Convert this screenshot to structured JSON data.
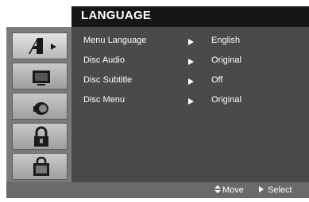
{
  "menu": {
    "title": "LANGUAGE"
  },
  "tabs": [
    {
      "icon": "language-icon",
      "active": true
    },
    {
      "icon": "display-icon",
      "active": false
    },
    {
      "icon": "audio-icon",
      "active": false
    },
    {
      "icon": "lock-icon",
      "active": false
    },
    {
      "icon": "others-icon",
      "active": false
    }
  ],
  "settings": [
    {
      "label": "Menu Language",
      "value": "English"
    },
    {
      "label": "Disc Audio",
      "value": "Original"
    },
    {
      "label": "Disc Subtitle",
      "value": "Off"
    },
    {
      "label": "Disc Menu",
      "value": "Original"
    }
  ],
  "footer": {
    "move_label": "Move",
    "select_label": "Select"
  },
  "colors": {
    "title_bar": "#161616",
    "panel": "#4a4a4a",
    "sidebar": "#7b7b7b",
    "footer": "#6a6a6a",
    "text": "#ffffff"
  }
}
